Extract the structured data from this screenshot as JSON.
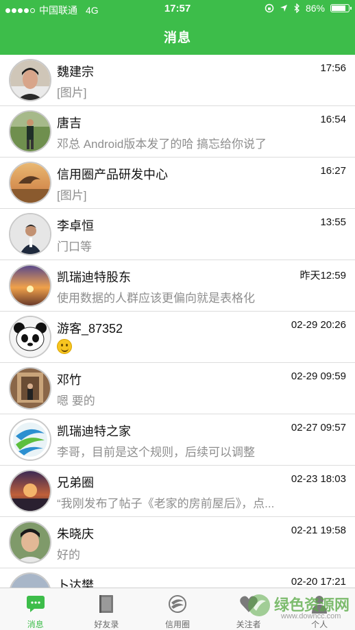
{
  "status_bar": {
    "carrier": "中国联通",
    "network": "4G",
    "time": "17:57",
    "battery": "86%",
    "battery_level": 0.86
  },
  "header": {
    "title": "消息"
  },
  "conversations": [
    {
      "name": "魏建宗",
      "time": "17:56",
      "preview": "[图片]"
    },
    {
      "name": "唐吉",
      "time": "16:54",
      "preview": "邓总    Android版本发了的哈   搞忘给你说了"
    },
    {
      "name": "信用圈产品研发中心",
      "time": "16:27",
      "preview": "[图片]"
    },
    {
      "name": "李卓恒",
      "time": "13:55",
      "preview": "门口等"
    },
    {
      "name": "凯瑞迪特股东",
      "time": "昨天12:59",
      "preview": "使用数据的人群应该更偏向就是表格化"
    },
    {
      "name": "游客_87352",
      "time": "02-29 20:26",
      "preview": ""
    },
    {
      "name": "邓竹",
      "time": "02-29 09:59",
      "preview": "嗯 要的"
    },
    {
      "name": "凯瑞迪特之家",
      "time": "02-27 09:57",
      "preview": "李哥，目前是这个规则，后续可以调整"
    },
    {
      "name": "兄弟圈",
      "time": "02-23 18:03",
      "preview": "“我刚发布了帖子《老家的房前屋后》，点..."
    },
    {
      "name": "朱晓庆",
      "time": "02-21 19:58",
      "preview": "好的"
    },
    {
      "name": "卜达樊",
      "time": "02-20 17:21",
      "preview": ""
    }
  ],
  "tabs": [
    {
      "label": "消息",
      "icon": "chat-icon",
      "active": true
    },
    {
      "label": "好友录",
      "icon": "contacts-book-icon",
      "active": false
    },
    {
      "label": "信用圈",
      "icon": "credit-circle-icon",
      "active": false
    },
    {
      "label": "关注者",
      "icon": "heart-icon",
      "active": false
    },
    {
      "label": "个人",
      "icon": "person-icon",
      "active": false
    }
  ],
  "watermark": {
    "text": "绿色资源网",
    "url": "www.downcc.com"
  },
  "colors": {
    "accent": "#3dbd4a",
    "preview_gray": "#8e8e8e",
    "divider": "#dcdcdc"
  }
}
